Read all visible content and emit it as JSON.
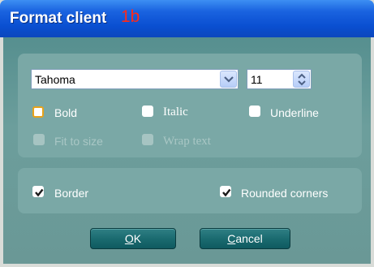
{
  "window": {
    "title": "Format client",
    "badge": "1b",
    "title_color": "#ffffff",
    "badge_color": "#ff2a1a"
  },
  "font": {
    "family": "Tahoma",
    "size": "11"
  },
  "style_options": [
    {
      "label": "Bold",
      "checked": false
    },
    {
      "label": "Italic",
      "checked": false
    },
    {
      "label": "Underline",
      "checked": false
    },
    {
      "label": "Fit to size",
      "checked": false,
      "disabled": true
    },
    {
      "label": "Wrap text",
      "checked": false,
      "disabled": true
    }
  ],
  "shape_options": [
    {
      "label": "Border",
      "checked": true
    },
    {
      "label": "Rounded corners",
      "checked": true
    }
  ],
  "buttons": {
    "ok_label": "OK",
    "ok_mnemonic": "O",
    "ok_rest": "K",
    "cancel_label": "Cancel",
    "cancel_mnemonic": "C",
    "cancel_rest": "ancel"
  }
}
